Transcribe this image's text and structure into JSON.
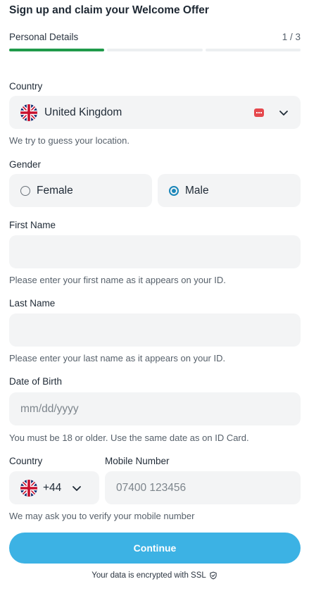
{
  "header": {
    "title": "Sign up and claim your Welcome Offer",
    "step_label": "Personal Details",
    "step_count": "1 / 3",
    "progress": {
      "current_step": 1,
      "total_steps": 3,
      "active_color": "#1f9a4a"
    }
  },
  "country": {
    "label": "Country",
    "value": "United Kingdom",
    "hint": "We try to guess your location.",
    "flag_icon": "uk-flag-icon"
  },
  "gender": {
    "label": "Gender",
    "options": [
      {
        "label": "Female",
        "selected": false
      },
      {
        "label": "Male",
        "selected": true
      }
    ]
  },
  "first_name": {
    "label": "First Name",
    "value": "",
    "hint": "Please enter your first name as it appears on your ID."
  },
  "last_name": {
    "label": "Last Name",
    "value": "",
    "hint": "Please enter your last name as it appears on your ID."
  },
  "dob": {
    "label": "Date of Birth",
    "placeholder": "mm/dd/yyyy",
    "hint": "You must be 18 or older. Use the same date as on ID Card."
  },
  "phone": {
    "country_label": "Country",
    "code": "+44",
    "number_label": "Mobile Number",
    "placeholder": "07400 123456",
    "hint": "We may ask you to verify your mobile number"
  },
  "actions": {
    "continue_label": "Continue",
    "accent_color": "#3cb2e4"
  },
  "footer": {
    "ssl_text": "Your data is encrypted with SSL"
  }
}
